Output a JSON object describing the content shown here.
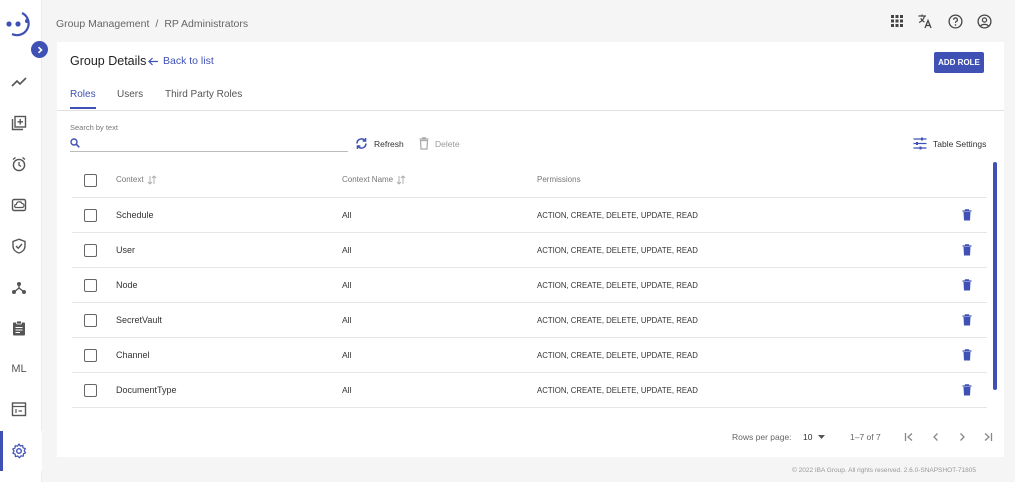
{
  "breadcrumb": {
    "parent": "Group Management",
    "separator": "/",
    "current": "RP Administrators"
  },
  "topbar": {
    "icons": [
      "apps-grid-icon",
      "translate-icon",
      "help-icon",
      "account-icon"
    ]
  },
  "sidebar": {
    "icons": [
      "logo-icon",
      "chevron-right-icon",
      "trend-icon",
      "library-add-icon",
      "alarm-icon",
      "cloud-panel-icon",
      "shield-check-icon",
      "hub-icon",
      "clipboard-icon",
      "calendar-icon",
      "gear-icon"
    ],
    "ml_label": "ML",
    "active": "settings"
  },
  "page": {
    "title": "Group Details",
    "back_label": "Back to list",
    "add_role_label": "ADD ROLE"
  },
  "tabs": [
    {
      "label": "Roles",
      "active": true
    },
    {
      "label": "Users",
      "active": false
    },
    {
      "label": "Third Party Roles",
      "active": false
    }
  ],
  "search": {
    "label": "Search by text",
    "value": "",
    "placeholder": ""
  },
  "actions": {
    "refresh": "Refresh",
    "delete": "Delete",
    "table_settings": "Table Settings"
  },
  "table": {
    "columns": [
      "Context",
      "Context Name",
      "Permissions"
    ],
    "rows": [
      {
        "context": "Schedule",
        "context_name": "All",
        "permissions": "ACTION, CREATE, DELETE, UPDATE, READ"
      },
      {
        "context": "User",
        "context_name": "All",
        "permissions": "ACTION, CREATE, DELETE, UPDATE, READ"
      },
      {
        "context": "Node",
        "context_name": "All",
        "permissions": "ACTION, CREATE, DELETE, UPDATE, READ"
      },
      {
        "context": "SecretVault",
        "context_name": "All",
        "permissions": "ACTION, CREATE, DELETE, UPDATE, READ"
      },
      {
        "context": "Channel",
        "context_name": "All",
        "permissions": "ACTION, CREATE, DELETE, UPDATE, READ"
      },
      {
        "context": "DocumentType",
        "context_name": "All",
        "permissions": "ACTION, CREATE, DELETE, UPDATE, READ"
      }
    ]
  },
  "paginator": {
    "rows_per_page_label": "Rows per page:",
    "rows_per_page_value": "10",
    "range_label": "1–7 of 7"
  },
  "footer": {
    "text": "© 2022 IBA Group. All rights reserved. 2.6.0-SNAPSHOT-71805"
  },
  "colors": {
    "accent": "#3f51b5"
  }
}
